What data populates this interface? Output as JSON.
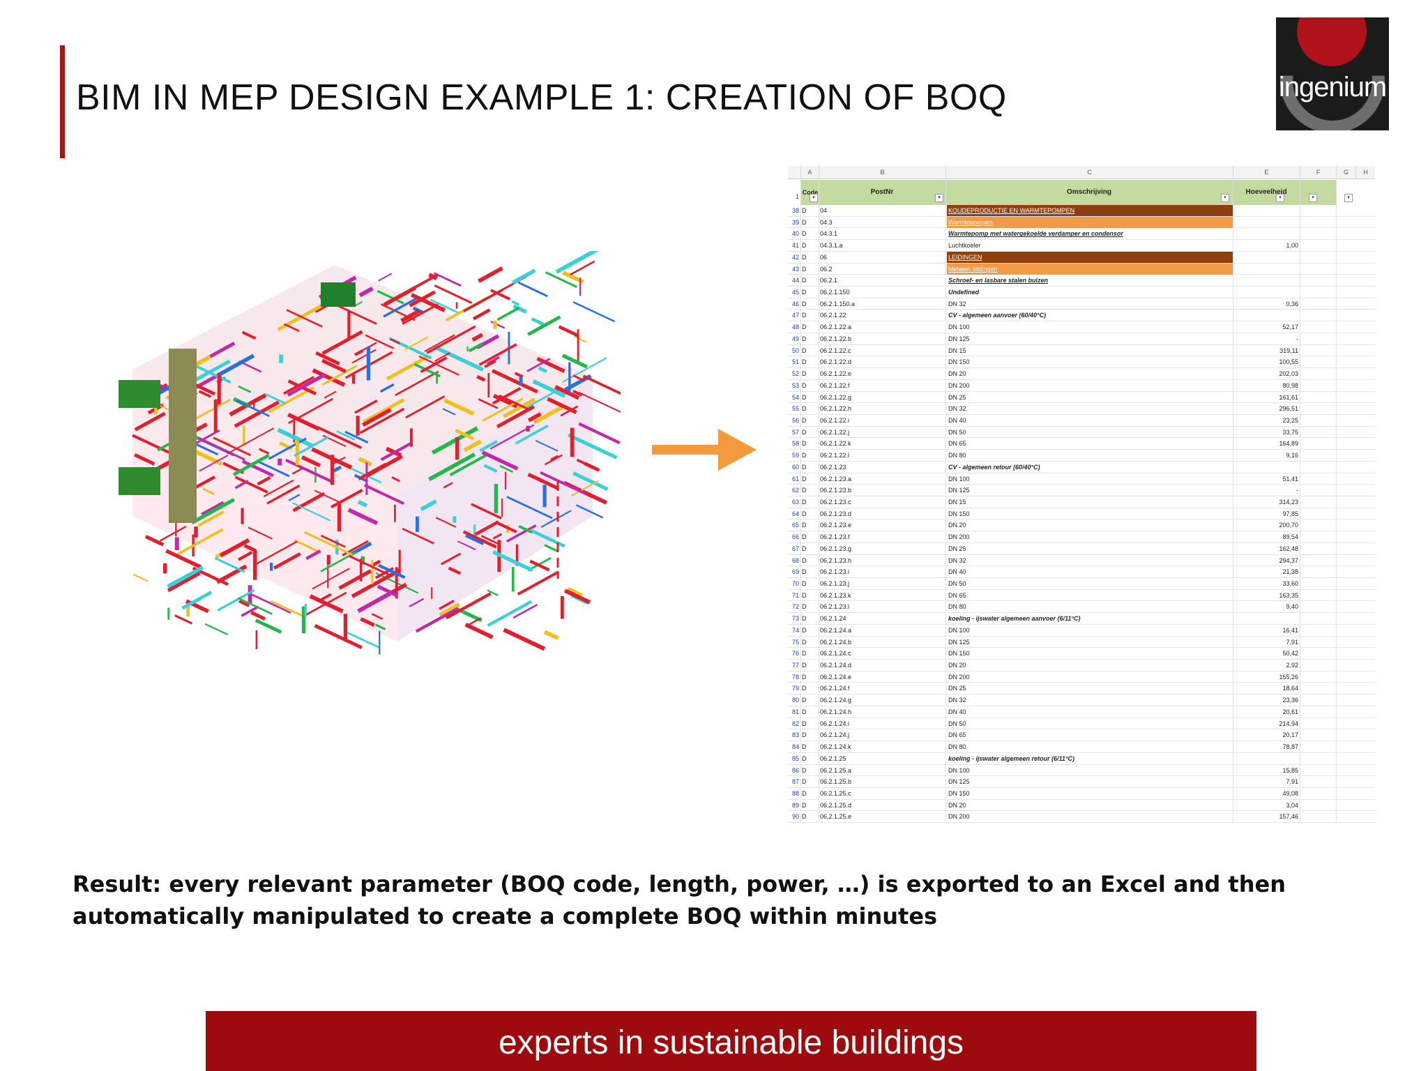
{
  "slide": {
    "title": "BIM IN MEP DESIGN EXAMPLE 1: CREATION OF BOQ",
    "logo_text": "ingenium",
    "result_text": "Result: every relevant parameter (BOQ code, length, power, …) is exported to an Excel and then automatically manipulated to create a complete BOQ within minutes",
    "footer_text": "experts in sustainable buildings",
    "colors": {
      "accent": "#a31919",
      "footer": "#9e0b0f",
      "arrow": "#f39a3c",
      "header_green": "#c4dba0",
      "section_dark": "#8f3f0f",
      "section_light": "#f39a46"
    }
  },
  "spreadsheet": {
    "column_letters": [
      "A",
      "B",
      "C",
      "E",
      "F",
      "G",
      "H"
    ],
    "header_row_number": "1",
    "headers": {
      "code": "Code",
      "postnr": "PostNr",
      "omschrijving": "Omschrijving",
      "hoeveelheid": "Hoeveelheid"
    },
    "rows": [
      {
        "n": "38",
        "a": "D",
        "b": "04",
        "c": "KOUDEPRODUCTIE EN WARMTEPOMPEN",
        "e": "",
        "style": "sec1"
      },
      {
        "n": "39",
        "a": "D",
        "b": "04.3",
        "c": "Warmtepompen",
        "e": "",
        "style": "sec2"
      },
      {
        "n": "40",
        "a": "D",
        "b": "04.3.1",
        "c": "Warmtepomp met watergekoelde verdamper en condensor",
        "e": "",
        "style": "sub"
      },
      {
        "n": "41",
        "a": "D",
        "b": "04.3.1.a",
        "c": "Luchtkoeler",
        "e": "1,00",
        "style": ""
      },
      {
        "n": "42",
        "a": "D",
        "b": "06",
        "c": "LEIDINGEN",
        "e": "",
        "style": "sec1"
      },
      {
        "n": "43",
        "a": "D",
        "b": "06.2",
        "c": "Metalen leidingen",
        "e": "",
        "style": "sec2"
      },
      {
        "n": "44",
        "a": "D",
        "b": "06.2.1",
        "c": "Schroef- en lasbare stalen buizen",
        "e": "",
        "style": "sub"
      },
      {
        "n": "45",
        "a": "D",
        "b": "06.2.1.150",
        "c": "Undefined",
        "e": "",
        "style": "grp"
      },
      {
        "n": "46",
        "a": "D",
        "b": "06.2.1.150.a",
        "c": "DN 32",
        "e": "0,36",
        "style": ""
      },
      {
        "n": "47",
        "a": "D",
        "b": "06.2.1.22",
        "c": "CV - algemeen aanvoer (60/40°C)",
        "e": "",
        "style": "grp"
      },
      {
        "n": "48",
        "a": "D",
        "b": "06.2.1.22.a",
        "c": "DN 100",
        "e": "52,17",
        "style": ""
      },
      {
        "n": "49",
        "a": "D",
        "b": "06.2.1.22.b",
        "c": "DN 125",
        "e": "-",
        "style": ""
      },
      {
        "n": "50",
        "a": "D",
        "b": "06.2.1.22.c",
        "c": "DN 15",
        "e": "319,11",
        "style": ""
      },
      {
        "n": "51",
        "a": "D",
        "b": "06.2.1.22.d",
        "c": "DN 150",
        "e": "100,55",
        "style": ""
      },
      {
        "n": "52",
        "a": "D",
        "b": "06.2.1.22.e",
        "c": "DN 20",
        "e": "202,03",
        "style": ""
      },
      {
        "n": "53",
        "a": "D",
        "b": "06.2.1.22.f",
        "c": "DN 200",
        "e": "80,98",
        "style": ""
      },
      {
        "n": "54",
        "a": "D",
        "b": "06.2.1.22.g",
        "c": "DN 25",
        "e": "161,61",
        "style": ""
      },
      {
        "n": "55",
        "a": "D",
        "b": "06.2.1.22.h",
        "c": "DN 32",
        "e": "296,51",
        "style": ""
      },
      {
        "n": "56",
        "a": "D",
        "b": "06.2.1.22.i",
        "c": "DN 40",
        "e": "23,25",
        "style": ""
      },
      {
        "n": "57",
        "a": "D",
        "b": "06.2.1.22.j",
        "c": "DN 50",
        "e": "33,75",
        "style": ""
      },
      {
        "n": "58",
        "a": "D",
        "b": "06.2.1.22.k",
        "c": "DN 65",
        "e": "164,89",
        "style": ""
      },
      {
        "n": "59",
        "a": "D",
        "b": "06.2.1.22.l",
        "c": "DN 80",
        "e": "9,16",
        "style": ""
      },
      {
        "n": "60",
        "a": "D",
        "b": "06.2.1.23",
        "c": "CV - algemeen retour (60/40°C)",
        "e": "",
        "style": "grp"
      },
      {
        "n": "61",
        "a": "D",
        "b": "06.2.1.23.a",
        "c": "DN 100",
        "e": "51,41",
        "style": ""
      },
      {
        "n": "62",
        "a": "D",
        "b": "06.2.1.23.b",
        "c": "DN 125",
        "e": "-",
        "style": ""
      },
      {
        "n": "63",
        "a": "D",
        "b": "06.2.1.23.c",
        "c": "DN 15",
        "e": "314,23",
        "style": ""
      },
      {
        "n": "64",
        "a": "D",
        "b": "06.2.1.23.d",
        "c": "DN 150",
        "e": "97,85",
        "style": ""
      },
      {
        "n": "65",
        "a": "D",
        "b": "06.2.1.23.e",
        "c": "DN 20",
        "e": "200,70",
        "style": ""
      },
      {
        "n": "66",
        "a": "D",
        "b": "06.2.1.23.f",
        "c": "DN 200",
        "e": "89,54",
        "style": ""
      },
      {
        "n": "67",
        "a": "D",
        "b": "06.2.1.23.g",
        "c": "DN 25",
        "e": "162,48",
        "style": ""
      },
      {
        "n": "68",
        "a": "D",
        "b": "06.2.1.23.h",
        "c": "DN 32",
        "e": "294,37",
        "style": ""
      },
      {
        "n": "69",
        "a": "D",
        "b": "06.2.1.23.i",
        "c": "DN 40",
        "e": "21,38",
        "style": ""
      },
      {
        "n": "70",
        "a": "D",
        "b": "06.2.1.23.j",
        "c": "DN 50",
        "e": "33,60",
        "style": ""
      },
      {
        "n": "71",
        "a": "D",
        "b": "06.2.1.23.k",
        "c": "DN 65",
        "e": "163,35",
        "style": ""
      },
      {
        "n": "72",
        "a": "D",
        "b": "06.2.1.23.l",
        "c": "DN 80",
        "e": "9,40",
        "style": ""
      },
      {
        "n": "73",
        "a": "D",
        "b": "06.2.1.24",
        "c": "koeling - ijswater algemeen aanvoer (6/11°C)",
        "e": "",
        "style": "grp"
      },
      {
        "n": "74",
        "a": "D",
        "b": "06.2.1.24.a",
        "c": "DN 100",
        "e": "16,41",
        "style": ""
      },
      {
        "n": "75",
        "a": "D",
        "b": "06.2.1.24.b",
        "c": "DN 125",
        "e": "7,91",
        "style": ""
      },
      {
        "n": "76",
        "a": "D",
        "b": "06.2.1.24.c",
        "c": "DN 150",
        "e": "50,42",
        "style": ""
      },
      {
        "n": "77",
        "a": "D",
        "b": "06.2.1.24.d",
        "c": "DN 20",
        "e": "2,92",
        "style": ""
      },
      {
        "n": "78",
        "a": "D",
        "b": "06.2.1.24.e",
        "c": "DN 200",
        "e": "155,26",
        "style": ""
      },
      {
        "n": "79",
        "a": "D",
        "b": "06.2.1.24.f",
        "c": "DN 25",
        "e": "18,64",
        "style": ""
      },
      {
        "n": "80",
        "a": "D",
        "b": "06.2.1.24.g",
        "c": "DN 32",
        "e": "23,36",
        "style": ""
      },
      {
        "n": "81",
        "a": "D",
        "b": "06.2.1.24.h",
        "c": "DN 40",
        "e": "20,61",
        "style": ""
      },
      {
        "n": "82",
        "a": "D",
        "b": "06.2.1.24.i",
        "c": "DN 50",
        "e": "214,94",
        "style": ""
      },
      {
        "n": "83",
        "a": "D",
        "b": "06.2.1.24.j",
        "c": "DN 65",
        "e": "20,17",
        "style": ""
      },
      {
        "n": "84",
        "a": "D",
        "b": "06.2.1.24.k",
        "c": "DN 80",
        "e": "78,87",
        "style": ""
      },
      {
        "n": "85",
        "a": "D",
        "b": "06.2.1.25",
        "c": "koeling - ijswater algemeen retour (6/11°C)",
        "e": "",
        "style": "grp"
      },
      {
        "n": "86",
        "a": "D",
        "b": "06.2.1.25.a",
        "c": "DN 100",
        "e": "15,85",
        "style": ""
      },
      {
        "n": "87",
        "a": "D",
        "b": "06.2.1.25.b",
        "c": "DN 125",
        "e": "7,91",
        "style": ""
      },
      {
        "n": "88",
        "a": "D",
        "b": "06.2.1.25.c",
        "c": "DN 150",
        "e": "49,08",
        "style": ""
      },
      {
        "n": "89",
        "a": "D",
        "b": "06.2.1.25.d",
        "c": "DN 20",
        "e": "3,04",
        "style": ""
      },
      {
        "n": "90",
        "a": "D",
        "b": "06.2.1.25.e",
        "c": "DN 200",
        "e": "157,46",
        "style": ""
      }
    ]
  }
}
